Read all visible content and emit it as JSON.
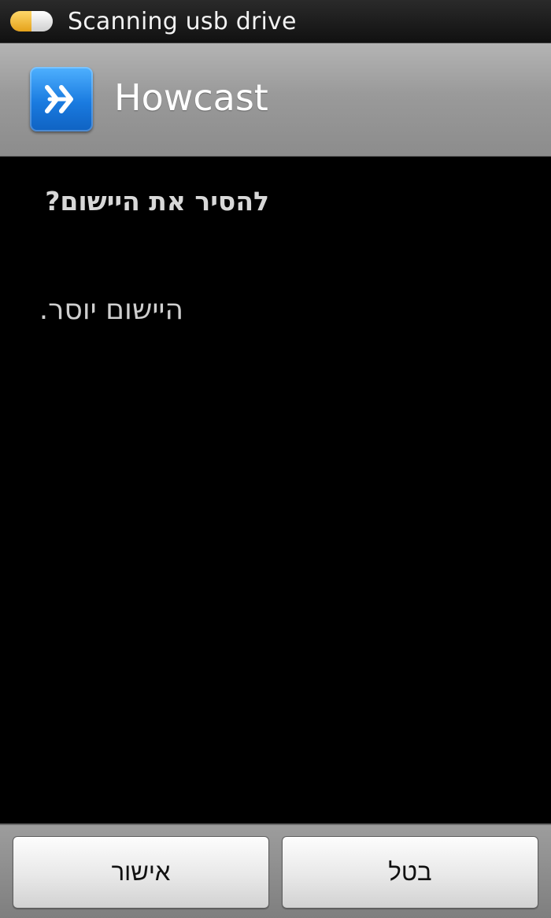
{
  "status_bar": {
    "notification_icon": "usb-drive-icon",
    "text": "Scanning usb drive"
  },
  "title_bar": {
    "app_icon": "howcast-logo-icon",
    "title": "Howcast"
  },
  "dialog": {
    "question": "להסיר את היישום?",
    "message": "היישום יוסר."
  },
  "buttons": {
    "ok_label": "אישור",
    "cancel_label": "בטל"
  },
  "colors": {
    "app_icon_blue": "#1a7be0",
    "usb_icon_amber": "#e5a21a"
  }
}
